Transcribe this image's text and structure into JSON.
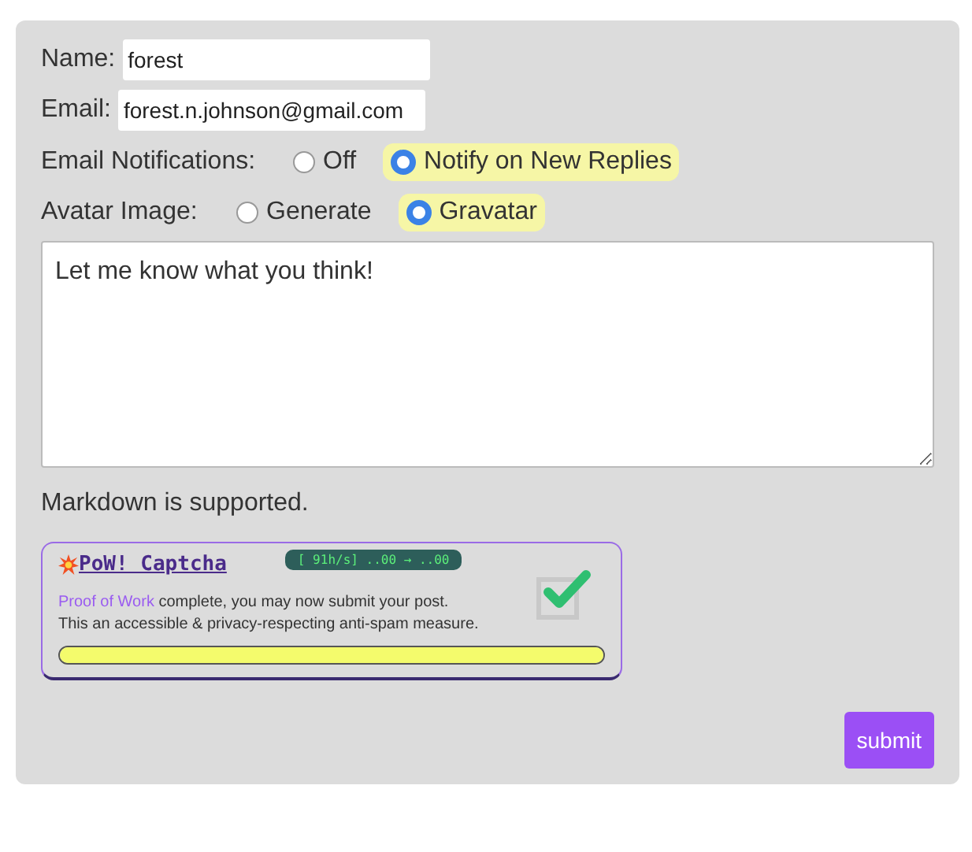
{
  "fields": [
    {
      "label": "Name:",
      "value": "forest"
    },
    {
      "label": "Email:",
      "value": "forest.n.johnson@gmail.com"
    }
  ],
  "radio_groups": [
    {
      "label": "Email Notifications:",
      "options": [
        {
          "label": "Off",
          "selected": false
        },
        {
          "label": "Notify on New Replies",
          "selected": true
        }
      ]
    },
    {
      "label": "Avatar Image:",
      "options": [
        {
          "label": "Generate",
          "selected": false
        },
        {
          "label": "Gravatar",
          "selected": true
        }
      ]
    }
  ],
  "comment": {
    "value": "Let me know what you think!"
  },
  "hint": "Markdown is supported.",
  "captcha": {
    "title": "PoW! Captcha",
    "speed": "[ 91h/s] ..00 → ..00",
    "link": "Proof of Work",
    "message": "complete, you may now submit your post.",
    "note": "This an accessible & privacy-respecting anti-spam measure.",
    "checked": true,
    "level": 1
  },
  "submit": "submit"
}
